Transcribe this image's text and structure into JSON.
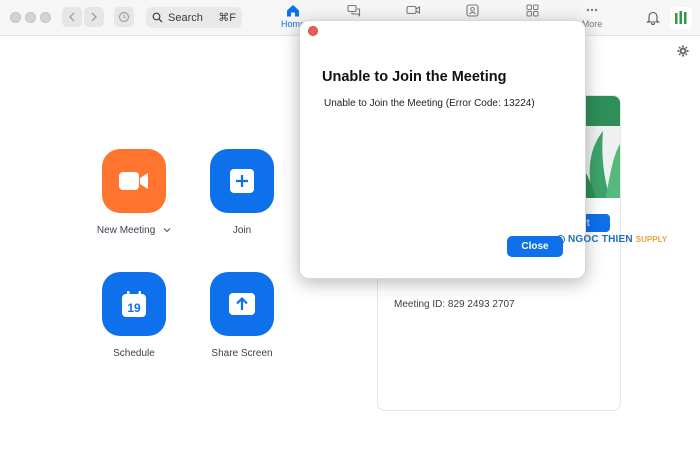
{
  "toolbar": {
    "search_placeholder": "Search",
    "search_shortcut": "⌘F",
    "tabs": [
      {
        "label": "Home",
        "icon": "home-icon"
      },
      {
        "label": "",
        "icon": "chat-icon"
      },
      {
        "label": "",
        "icon": "meetings-icon"
      },
      {
        "label": "",
        "icon": "contacts-icon"
      },
      {
        "label": "",
        "icon": "apps-icon"
      },
      {
        "label": "More",
        "icon": "more-icon"
      }
    ]
  },
  "home": {
    "new_meeting": "New Meeting",
    "join": "Join",
    "schedule": "Schedule",
    "schedule_day": "19",
    "share_screen": "Share Screen"
  },
  "card": {
    "start_label": "art",
    "meeting_id": "Meeting ID: 829 2493 2707"
  },
  "dialog": {
    "title": "Unable to Join the Meeting",
    "message": "Unable to Join the Meeting (Error Code: 13224)",
    "close_label": "Close"
  },
  "watermark": {
    "name": "NGOC THIEN",
    "tag": "SUPPLY"
  },
  "colors": {
    "accent": "#0e71eb",
    "new_meeting": "#ff742e",
    "close_dot": "#ee5a55"
  }
}
